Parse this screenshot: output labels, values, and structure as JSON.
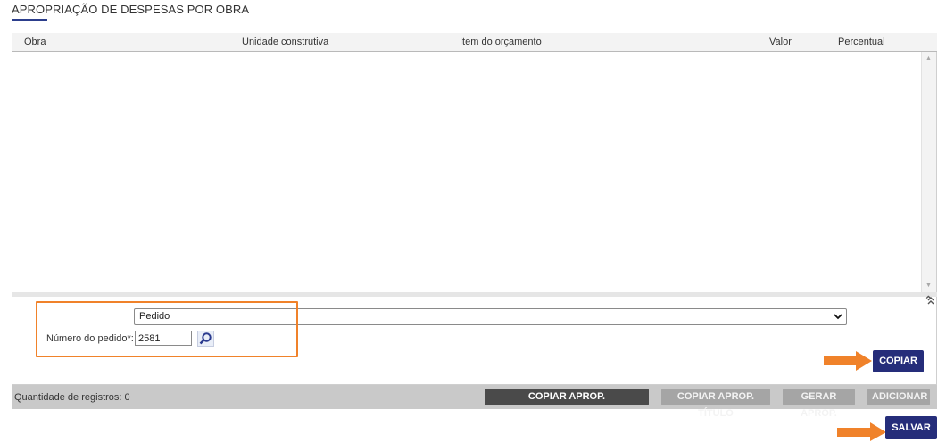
{
  "section": {
    "title": "APROPRIAÇÃO DE DESPESAS POR OBRA"
  },
  "grid": {
    "columns": [
      "Obra",
      "Unidade construtiva",
      "Item do orçamento",
      "Valor",
      "Percentual"
    ]
  },
  "copy_form": {
    "source_type": "Pedido",
    "order_label": "Número do pedido*:",
    "order_value": "2581",
    "copy_button": "COPIAR"
  },
  "footer": {
    "count_label": "Quantidade de registros: 0",
    "buttons": [
      "COPIAR APROP. CONTRATO/PEDIDO",
      "COPIAR APROP. TÍTULO",
      "GERAR APROP.",
      "ADICIONAR"
    ]
  },
  "save_button": "SALVAR",
  "colors": {
    "primary": "#252d7a",
    "highlight": "#f0822a",
    "footer_bar": "#c9c9c9"
  },
  "icons": [
    "lookup-search-icon",
    "collapse-chevron-icon",
    "scroll-up-icon",
    "scroll-down-icon",
    "dropdown-caret-icon",
    "arrow-pointer-icon"
  ]
}
